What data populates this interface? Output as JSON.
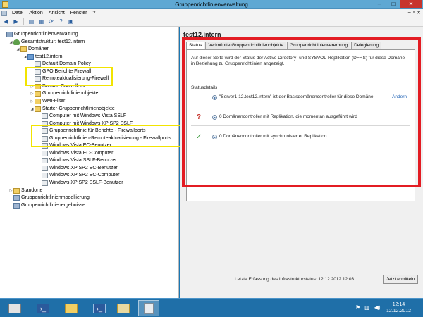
{
  "window": {
    "title": "Gruppenrichtlinienverwaltung",
    "minimize": "–",
    "maximize": "□",
    "close": "✕"
  },
  "menu": {
    "items": [
      "Datei",
      "Aktion",
      "Ansicht",
      "Fenster",
      "?"
    ],
    "mdi_min": "–",
    "mdi_max": "▫",
    "mdi_close": "✕"
  },
  "tree": {
    "items": [
      {
        "label": "Gruppenrichtlinienverwaltung",
        "indent": 0,
        "toggle": "",
        "icon": "root"
      },
      {
        "label": "Gesamtstruktur: test12.intern",
        "indent": 1,
        "toggle": "◢",
        "icon": "forest"
      },
      {
        "label": "Domänen",
        "indent": 2,
        "toggle": "◢",
        "icon": "folder"
      },
      {
        "label": "test12.intern",
        "indent": 3,
        "toggle": "◢",
        "icon": "domain"
      },
      {
        "label": "Default Domain Policy",
        "indent": 4,
        "toggle": "",
        "icon": "gpo"
      },
      {
        "label": "GPO Berichte Firewall",
        "indent": 4,
        "toggle": "",
        "icon": "gpo"
      },
      {
        "label": "Remoteaktualisierung-Firewall",
        "indent": 4,
        "toggle": "",
        "icon": "gpo"
      },
      {
        "label": "Domain Controllers",
        "indent": 4,
        "toggle": "▷",
        "icon": "folder"
      },
      {
        "label": "Gruppenrichtlinienobjekte",
        "indent": 4,
        "toggle": "▷",
        "icon": "folder"
      },
      {
        "label": "WMI-Filter",
        "indent": 4,
        "toggle": "▷",
        "icon": "folder"
      },
      {
        "label": "Starter-Gruppenrichtlinienobjekte",
        "indent": 4,
        "toggle": "◢",
        "icon": "folder"
      },
      {
        "label": "Computer mit Windows Vista SSLF",
        "indent": 5,
        "toggle": "",
        "icon": "gpo"
      },
      {
        "label": "Computer mit Windows XP SP2 SSLF",
        "indent": 5,
        "toggle": "",
        "icon": "gpo"
      },
      {
        "label": "Gruppenrichtlinie für Berichte - Firewallports",
        "indent": 5,
        "toggle": "",
        "icon": "gpo"
      },
      {
        "label": "Gruppenrichtlinien-Remoteaktualisierung - Firewallports",
        "indent": 5,
        "toggle": "",
        "icon": "gpo"
      },
      {
        "label": "Windows Vista EC-Benutzer",
        "indent": 5,
        "toggle": "",
        "icon": "gpo"
      },
      {
        "label": "Windows Vista EC-Computer",
        "indent": 5,
        "toggle": "",
        "icon": "gpo"
      },
      {
        "label": "Windows Vista SSLF-Benutzer",
        "indent": 5,
        "toggle": "",
        "icon": "gpo"
      },
      {
        "label": "Windows XP SP2 EC-Benutzer",
        "indent": 5,
        "toggle": "",
        "icon": "gpo"
      },
      {
        "label": "Windows XP SP2 EC-Computer",
        "indent": 5,
        "toggle": "",
        "icon": "gpo"
      },
      {
        "label": "Windows XP SP2 SSLF-Benutzer",
        "indent": 5,
        "toggle": "",
        "icon": "gpo"
      },
      {
        "label": "Standorte",
        "indent": 1,
        "toggle": "▷",
        "icon": "folder"
      },
      {
        "label": "Gruppenrichtlinienmodellierung",
        "indent": 1,
        "toggle": "",
        "icon": "filter"
      },
      {
        "label": "Gruppenrichtlinienergebnisse",
        "indent": 1,
        "toggle": "",
        "icon": "filter"
      }
    ]
  },
  "main": {
    "title": "test12.intern",
    "tabs": [
      "Status",
      "Verknüpfte Gruppenrichtlinienobjekte",
      "Gruppenrichtlinienvererbung",
      "Delegierung"
    ],
    "description": "Auf dieser Seite wird der Status der Active Directory- und SYSVOL-Replikation (DFRS) für diese Domäne in Beziehung zu Gruppenrichtlinien angezeigt.",
    "section_title": "Statusdetails",
    "status_rows": [
      {
        "icon": "",
        "text": "\"Server1-12.test12.intern\" ist der Basisdomänencontroller für diese Domäne.",
        "link": "Ändern"
      },
      {
        "icon": "?",
        "text": "0 Domänencontroller mit Replikation, die momentan ausgeführt wird",
        "link": ""
      },
      {
        "icon": "✓",
        "text": "0 Domänencontroller mit synchronisierter Replikation",
        "link": ""
      }
    ],
    "footer_text": "Letzte Erfassung des Infrastrukturstatus: 12.12.2012 12:03",
    "refresh_button": "Jetzt ermitteln"
  },
  "taskbar": {
    "time": "12:14",
    "date": "12.12.2012"
  },
  "colors": {
    "highlight_yellow": "#f2e400",
    "highlight_red": "#e31c23",
    "question_icon": "#c7342c",
    "check_icon": "#3a9a3a"
  }
}
